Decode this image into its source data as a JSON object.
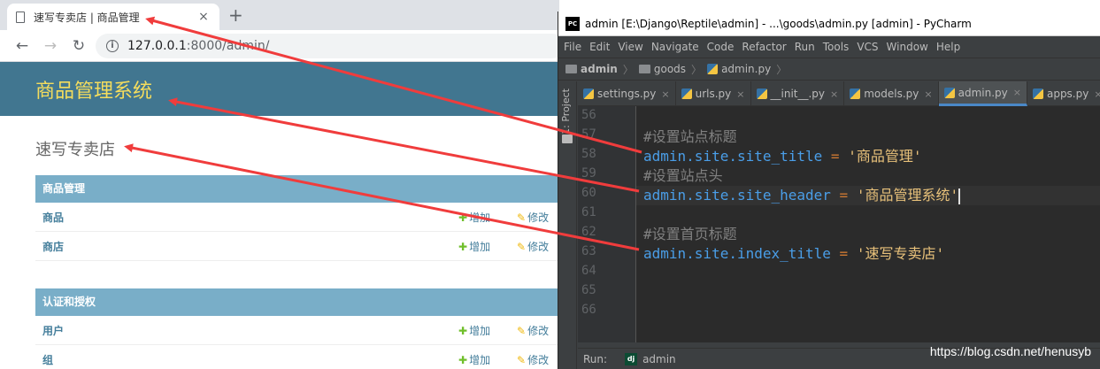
{
  "browser": {
    "tab_title": "速写专卖店 | 商品管理",
    "tab_close": "×",
    "new_tab": "+",
    "nav": {
      "back": "←",
      "forward": "→",
      "reload": "↻"
    },
    "info_glyph": "i",
    "url_host": "127.0.0.1",
    "url_path": ":8000/admin/"
  },
  "admin": {
    "site_header": "商品管理系统",
    "index_title": "速写专卖店",
    "add_label": "增加",
    "change_label": "修改",
    "modules": [
      {
        "caption": "商品管理",
        "rows": [
          "商品",
          "商店"
        ]
      },
      {
        "caption": "认证和授权",
        "rows": [
          "用户",
          "组"
        ]
      }
    ],
    "colors": {
      "header_bg": "#417690",
      "brand": "#f5dd5d",
      "caption_bg": "#79aec8",
      "link": "#447e9b"
    }
  },
  "ide": {
    "logo_text": "PC",
    "window_title": "admin [E:\\Django\\Reptile\\admin] - ...\\goods\\admin.py [admin] - PyCharm",
    "menu": [
      "File",
      "Edit",
      "View",
      "Navigate",
      "Code",
      "Refactor",
      "Run",
      "Tools",
      "VCS",
      "Window",
      "Help"
    ],
    "breadcrumb": [
      "admin",
      "goods",
      "admin.py"
    ],
    "breadcrumb_sep": "〉",
    "sidebar_label": "1: Project",
    "tabs": [
      {
        "label": "settings.py",
        "close": "×"
      },
      {
        "label": "urls.py",
        "close": "×"
      },
      {
        "label": "__init__.py",
        "close": "×"
      },
      {
        "label": "models.py",
        "close": "×"
      },
      {
        "label": "admin.py",
        "close": "×",
        "active": true
      },
      {
        "label": "apps.py",
        "close": "×"
      }
    ],
    "line_numbers": [
      "56",
      "57",
      "58",
      "59",
      "60",
      "61",
      "62",
      "63",
      "64",
      "65",
      "66"
    ],
    "code": {
      "c57": "#设置站点标题",
      "l58_lhs": "admin.site.site_title",
      "l58_eq": " = ",
      "l58_str": "'商品管理'",
      "c59": "#设置站点头",
      "l60_lhs": "admin.site.site_header",
      "l60_eq": " = ",
      "l60_str": "'商品管理系统'",
      "c62": "#设置首页标题",
      "l63_lhs": "admin.site.index_title",
      "l63_eq": " = ",
      "l63_str": "'速写专卖店'"
    },
    "run_label": "Run:",
    "run_icon_text": "dj",
    "run_config": "admin"
  },
  "watermark": "https://blog.csdn.net/henusyb"
}
